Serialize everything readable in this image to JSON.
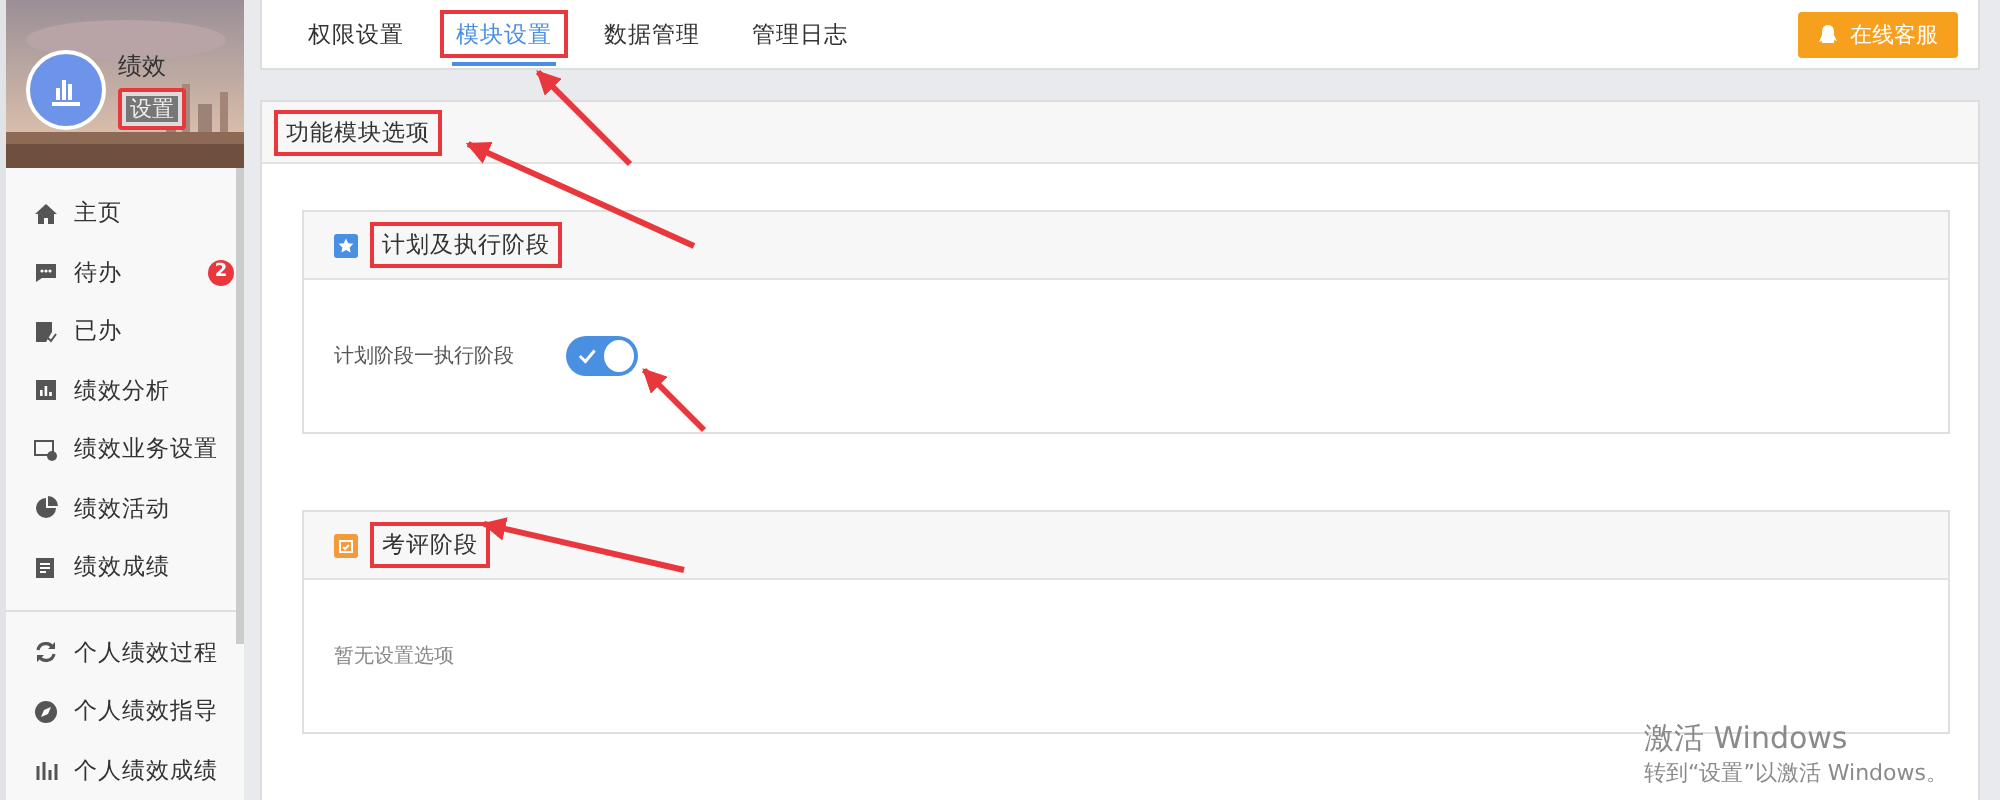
{
  "profile": {
    "kind": "picture",
    "name": "绩效",
    "settings_button": {
      "label": "设置",
      "highlighted": true
    }
  },
  "sidebar": {
    "items": [
      {
        "label": "主页",
        "divider_above": false
      },
      {
        "label": "待办",
        "divider_above": false,
        "badge": "2"
      },
      {
        "label": "已办",
        "divider_above": false
      },
      {
        "label": "绩效分析",
        "divider_above": false
      },
      {
        "label": "绩效业务设置",
        "divider_above": false
      },
      {
        "label": "绩效活动",
        "divider_above": false
      },
      {
        "label": "绩效成绩",
        "divider_above": false
      },
      {
        "label": "个人绩效过程",
        "divider_above": true
      },
      {
        "label": "个人绩效指导",
        "divider_above": false
      },
      {
        "label": "个人绩效成绩",
        "divider_above": false
      }
    ]
  },
  "tabs": [
    {
      "label": "权限设置",
      "selected": false,
      "highlighted": false
    },
    {
      "label": "模块设置",
      "selected": true,
      "highlighted": true
    },
    {
      "label": "数据管理",
      "selected": false,
      "highlighted": false
    },
    {
      "label": "管理日志",
      "selected": false,
      "highlighted": false
    }
  ],
  "support_button": {
    "label": "在线客服"
  },
  "panel": {
    "title": "功能模块选项",
    "highlighted": true,
    "sections": [
      {
        "title": "计划及执行阶段",
        "kind": "star",
        "highlighted": true,
        "options": [
          {
            "label": "计划阶段一执行阶段",
            "on": true
          }
        ]
      },
      {
        "title": "考评阶段",
        "kind": "calendar",
        "highlighted": true,
        "empty_text": "暂无设置选项"
      }
    ]
  },
  "os_notice": {
    "title": "激活 Windows",
    "text": "转到“设置”以激活 Windows。"
  }
}
